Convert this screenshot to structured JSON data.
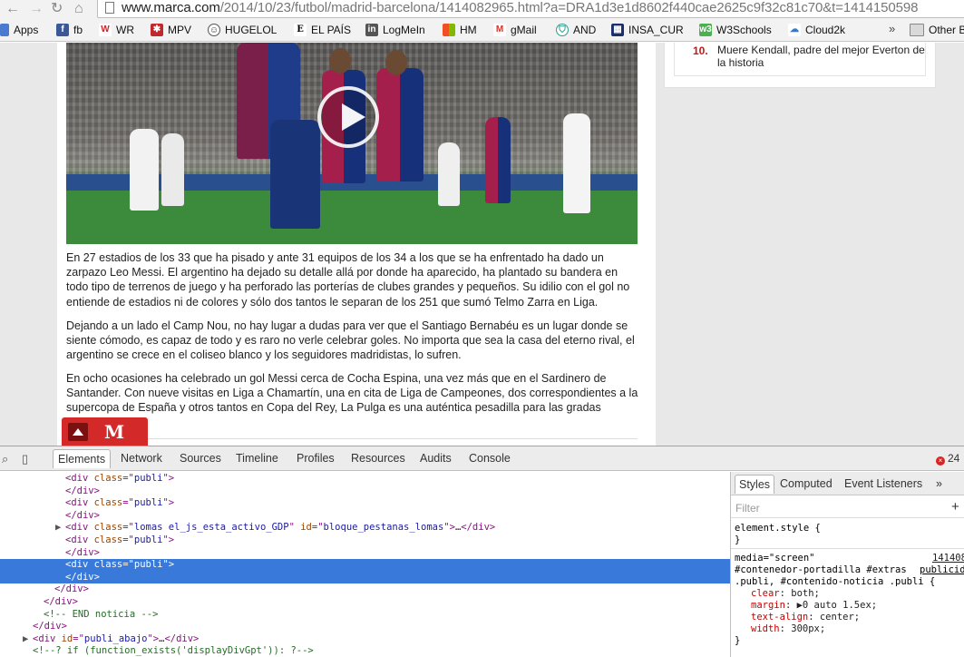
{
  "browser": {
    "url_host": "www.marca.com",
    "url_path": "/2014/10/23/futbol/madrid-barcelona/1414082965.html?a=DRA1d3e1d8602f440cae2625c9f32c81c70&t=1414150598",
    "bookmarks": [
      "Apps",
      "fb",
      "WR",
      "MPV",
      "HUGELOL",
      "EL PAÍS",
      "LogMeIn",
      "HM",
      "gMail",
      "AND",
      "INSA_CUR",
      "W3Schools",
      "Cloud2k"
    ],
    "more_label": "»",
    "other_bookmarks": "Other B"
  },
  "sidebar": {
    "rank": "10.",
    "headline": "Muere Kendall, padre del mejor Everton de la historia"
  },
  "article": {
    "paragraphs": [
      "En 27 estadios de los 33 que ha pisado y ante 31 equipos de los 34 a los que se ha enfrentado ha dado un zarpazo Leo Messi. El argentino ha dejado su detalle allá por donde ha aparecido, ha plantado su bandera en todo tipo de terrenos de juego y ha perforado las porterías de clubes grandes y pequeños. Su idilio con el gol no entiende de estadios ni de colores y sólo dos tantos le separan de los 251 que sumó Telmo Zarra en Liga.",
      "Dejando a un lado el Camp Nou, no hay lugar a dudas para ver que el Santiago Bernabéu es un lugar donde se siente cómodo, es capaz de todo y es raro no verle celebrar goles. No importa que sea la casa del eterno rival, el argentino se crece en el coliseo blanco y los seguidores madridistas, lo sufren.",
      "En ocho ocasiones ha celebrado un gol Messi cerca de Cocha Espina, una vez más que en el Sardinero de Santander. Con nueve visitas en Liga a Chamartín, una en cita de Liga de Campeones, dos correspondientes a la supercopa de España y otros tantos en Copa del Rey, La Pulga es una auténtica pesadilla para las gradas"
    ],
    "logo_letter": "M"
  },
  "devtools": {
    "tabs": [
      "Elements",
      "Network",
      "Sources",
      "Timeline",
      "Profiles",
      "Resources",
      "Audits",
      "Console"
    ],
    "error_count": "24",
    "dom_lines": [
      {
        "indent": 72,
        "arrow": "",
        "parts": [
          [
            "tag",
            "<div "
          ],
          [
            "attr",
            "class"
          ],
          [
            "tag",
            "=\""
          ],
          [
            "val",
            "publi"
          ],
          [
            "tag",
            "\">"
          ]
        ]
      },
      {
        "indent": 72,
        "arrow": "",
        "parts": [
          [
            "tag",
            "</div>"
          ]
        ]
      },
      {
        "indent": 72,
        "arrow": "",
        "parts": [
          [
            "tag",
            "<div "
          ],
          [
            "attr",
            "class"
          ],
          [
            "tag",
            "=\""
          ],
          [
            "val",
            "publi"
          ],
          [
            "tag",
            "\">"
          ]
        ]
      },
      {
        "indent": 72,
        "arrow": "",
        "parts": [
          [
            "tag",
            "</div>"
          ]
        ]
      },
      {
        "indent": 72,
        "arrow": "▶",
        "parts": [
          [
            "tag",
            "<div "
          ],
          [
            "attr",
            "class"
          ],
          [
            "tag",
            "=\""
          ],
          [
            "val",
            "lomas el_js_esta_activo_GDP"
          ],
          [
            "tag",
            "\" "
          ],
          [
            "attr",
            "id"
          ],
          [
            "tag",
            "=\""
          ],
          [
            "val",
            "bloque_pestanas_lomas"
          ],
          [
            "tag",
            "\">"
          ],
          [
            "txt",
            "…"
          ],
          [
            "tag",
            "</div>"
          ]
        ]
      },
      {
        "indent": 72,
        "arrow": "",
        "parts": [
          [
            "tag",
            "<div "
          ],
          [
            "attr",
            "class"
          ],
          [
            "tag",
            "=\""
          ],
          [
            "val",
            "publi"
          ],
          [
            "tag",
            "\">"
          ]
        ]
      },
      {
        "indent": 72,
        "arrow": "",
        "parts": [
          [
            "tag",
            "</div>"
          ]
        ]
      },
      {
        "indent": 72,
        "arrow": "",
        "parts": [
          [
            "tag",
            "<div "
          ],
          [
            "attr",
            "class"
          ],
          [
            "tag",
            "=\""
          ],
          [
            "val",
            "publi"
          ],
          [
            "tag",
            "\">"
          ]
        ],
        "selected": true
      },
      {
        "indent": 72,
        "arrow": "",
        "parts": [
          [
            "tag",
            "</div>"
          ]
        ],
        "selected": true
      },
      {
        "indent": 60,
        "arrow": "",
        "parts": [
          [
            "tag",
            "</div>"
          ]
        ]
      },
      {
        "indent": 48,
        "arrow": "",
        "parts": [
          [
            "tag",
            "</div>"
          ]
        ]
      },
      {
        "indent": 48,
        "arrow": "",
        "parts": [
          [
            "cmt",
            "<!-- END noticia -->"
          ]
        ]
      },
      {
        "indent": 36,
        "arrow": "",
        "parts": [
          [
            "tag",
            "</div>"
          ]
        ]
      },
      {
        "indent": 36,
        "arrow": "▶",
        "parts": [
          [
            "tag",
            "<div "
          ],
          [
            "attr",
            "id"
          ],
          [
            "tag",
            "=\""
          ],
          [
            "val",
            "publi_abajo"
          ],
          [
            "tag",
            "\">"
          ],
          [
            "txt",
            "…"
          ],
          [
            "tag",
            "</div>"
          ]
        ]
      },
      {
        "indent": 36,
        "arrow": "",
        "parts": [
          [
            "cmt",
            "<!--? if (function_exists('displayDivGpt')): ?-->"
          ]
        ]
      }
    ],
    "styles": {
      "tabs": [
        "Styles",
        "Computed",
        "Event Listeners"
      ],
      "more": "»",
      "filter_placeholder": "Filter",
      "element_style": "element.style {",
      "close_brace": "}",
      "media": "media=\"screen\"",
      "source": "141408",
      "selector_1": "#contenedor-portadilla #extras",
      "selector_1b": "publicid",
      "selector_2": ".publi, #contenido-noticia .publi {",
      "rules": [
        {
          "prop": "clear",
          "value": "both;"
        },
        {
          "prop": "margin",
          "value": "▶0 auto 1.5ex;"
        },
        {
          "prop": "text-align",
          "value": "center;"
        },
        {
          "prop": "width",
          "value": "300px;"
        }
      ]
    }
  }
}
